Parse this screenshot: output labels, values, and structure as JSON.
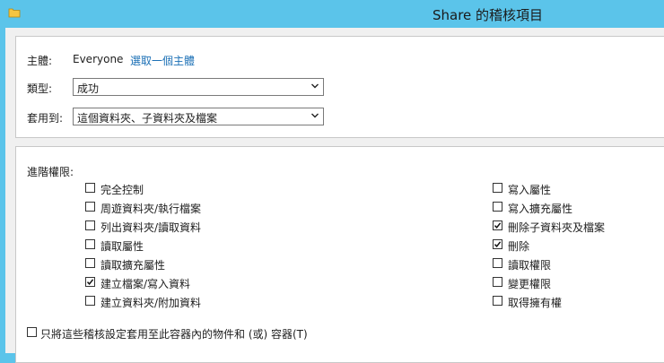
{
  "window": {
    "title": "Share 的稽核項目"
  },
  "subject": {
    "label": "主體:",
    "value": "Everyone",
    "link": "選取一個主體"
  },
  "type": {
    "label": "類型:",
    "selected": "成功"
  },
  "applies_to": {
    "label": "套用到:",
    "selected": "這個資料夾、子資料夾及檔案"
  },
  "advanced": {
    "label": "進階權限:",
    "left": [
      {
        "label": "完全控制",
        "checked": false
      },
      {
        "label": "周遊資料夾/執行檔案",
        "checked": false
      },
      {
        "label": "列出資料夾/讀取資料",
        "checked": false
      },
      {
        "label": "讀取屬性",
        "checked": false
      },
      {
        "label": "讀取擴充屬性",
        "checked": false
      },
      {
        "label": "建立檔案/寫入資料",
        "checked": true
      },
      {
        "label": "建立資料夾/附加資料",
        "checked": false
      }
    ],
    "right": [
      {
        "label": "寫入屬性",
        "checked": false
      },
      {
        "label": "寫入擴充屬性",
        "checked": false
      },
      {
        "label": "刪除子資料夾及檔案",
        "checked": true
      },
      {
        "label": "刪除",
        "checked": true
      },
      {
        "label": "讀取權限",
        "checked": false
      },
      {
        "label": "變更權限",
        "checked": false
      },
      {
        "label": "取得擁有權",
        "checked": false
      }
    ]
  },
  "apply_only": {
    "label": "只將這些稽核設定套用至此容器內的物件和 (或) 容器(T)",
    "checked": false
  }
}
